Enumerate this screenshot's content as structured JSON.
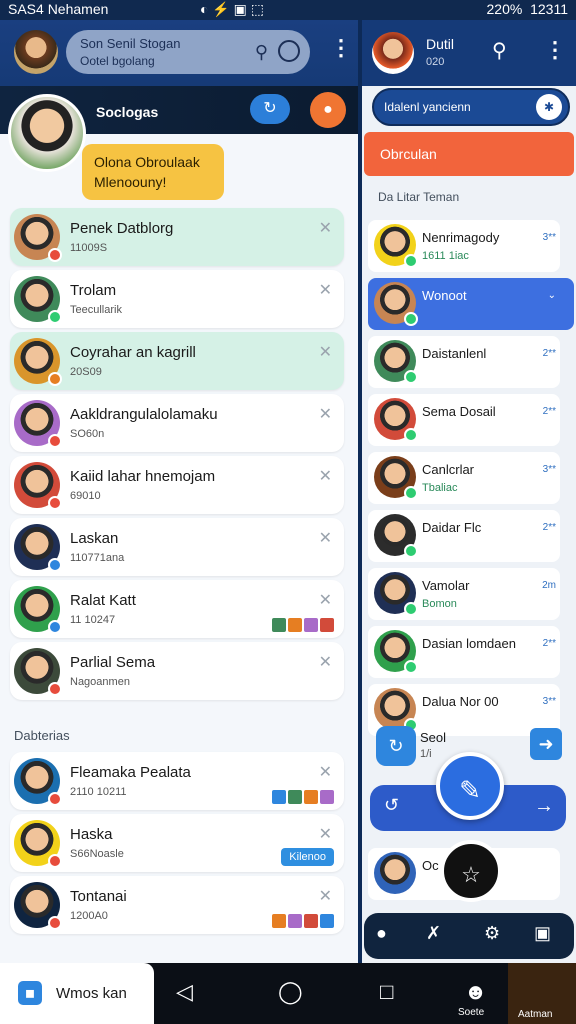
{
  "status": {
    "left": "SAS4 Nehamen",
    "mid": "◐ ⚡ ▣ ⬚",
    "battery": "220%",
    "time": "12311"
  },
  "left": {
    "search_title": "Son Senil Stogan",
    "search_sub": "Ootel bgolang",
    "featured_title": "Soclogas",
    "featured_bubble": "Olona Obroulaak Mlenoouny!",
    "chats": [
      {
        "name": "Penek Datblorg",
        "sub": "11009S",
        "mint": true,
        "avatar": "#c78553",
        "badge": "#e74c3c"
      },
      {
        "name": "Trolam",
        "sub": "Teecullarik",
        "mint": false,
        "avatar": "#3f8a5a",
        "badge": "#2ecc71"
      },
      {
        "name": "Coyrahar an kagrill",
        "sub": "20S09",
        "mint": true,
        "avatar": "#d9952b",
        "badge": "#e67e22"
      },
      {
        "name": "Aakldrangulalolamaku",
        "sub": "SO60n",
        "mint": false,
        "avatar": "#a86bc8",
        "badge": "#e74c3c"
      },
      {
        "name": "Kaiid lahar hnemojam",
        "sub": "69010",
        "mint": false,
        "avatar": "#d24b3a",
        "badge": "#e74c3c"
      },
      {
        "name": "Laskan",
        "sub": "110771ana",
        "mint": false,
        "avatar": "#1f2f55",
        "badge": "#2e86de"
      },
      {
        "name": "Ralat Katt",
        "sub": "11 10247",
        "mint": false,
        "avatar": "#2fa04c",
        "badge": "#2e86de"
      },
      {
        "name": "Parlial Sema",
        "sub": "Nagoanmen",
        "mint": false,
        "avatar": "#3c4a3a",
        "badge": "#e74c3c"
      }
    ],
    "section2_label": "Dabterias",
    "chats2": [
      {
        "name": "Fleamaka  Pealata",
        "sub": "2110 10211",
        "mint": false,
        "avatar": "#1b6fb0",
        "badge": "#e74c3c"
      },
      {
        "name": "Haska",
        "sub": "S66Noasle",
        "mint": false,
        "avatar": "#f2d21a",
        "badge": "#e74c3c",
        "pill": "Kilenoo"
      },
      {
        "name": "Tontanai",
        "sub": "1200A0",
        "mint": false,
        "avatar": "#0f2440",
        "badge": "#e74c3c"
      }
    ]
  },
  "right": {
    "title": "Dutil",
    "sub": "020",
    "search_bar": "Idalenl yancienn",
    "orange_banner": "Obrculan",
    "list_label": "Da Litar Teman",
    "chats": [
      {
        "name": "Nenrimagody",
        "sub": "1611 1iac",
        "time": "3**",
        "avatar": "#f2d21a",
        "blue": false
      },
      {
        "name": "Wonoot",
        "sub": "",
        "time": "⌄",
        "avatar": "#c78553",
        "blue": true
      },
      {
        "name": "Daistanlenl",
        "sub": "",
        "time": "2**",
        "avatar": "#3f8a5a",
        "blue": false
      },
      {
        "name": "Sema Dosail",
        "sub": "",
        "time": "2**",
        "avatar": "#d24b3a",
        "blue": false
      },
      {
        "name": "Canlcrlar",
        "sub": "Tbaliac",
        "time": "3**",
        "avatar": "#7a3e1a",
        "blue": false
      },
      {
        "name": "Daidar Flc",
        "sub": "",
        "time": "2**",
        "avatar": "#2c2c2c",
        "blue": false
      },
      {
        "name": "Vamolar",
        "sub": "Bomon",
        "time": "2m",
        "avatar": "#1f2f55",
        "blue": false
      },
      {
        "name": "Dasian lomdaen",
        "sub": "",
        "time": "2**",
        "avatar": "#2fa04c",
        "blue": false
      },
      {
        "name": "Dalua Nor 00",
        "sub": "",
        "time": "3**",
        "avatar": "#c78553",
        "blue": false
      }
    ],
    "seel_title": "Seol",
    "seel_sub": "1/i",
    "last_name": "Oc",
    "last_sub": "",
    "last_avatar": "#2f63b8"
  },
  "nav": {
    "home": "Wmos kan",
    "search": "Soete",
    "profile": "Aatman"
  }
}
